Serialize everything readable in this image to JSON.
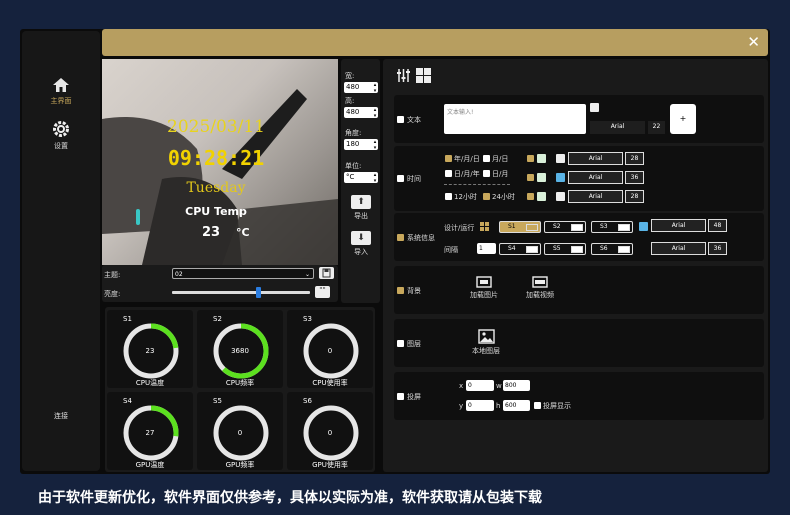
{
  "nav": {
    "home": "主界面",
    "settings": "设置",
    "connect": "连接"
  },
  "preview": {
    "date": "2025/03/11",
    "time": "09:28:21",
    "weekday": "Tuesday",
    "cpu_label": "CPU Temp",
    "cpu_value": "23",
    "cpu_unit": "°C"
  },
  "controls": {
    "theme_label": "主题:",
    "theme_value": "02",
    "brightness_label": "亮度:",
    "brightness": 0.62
  },
  "rightcol": {
    "width_label": "宽:",
    "width_value": "480",
    "height_label": "高:",
    "height_value": "480",
    "angle_label": "角度:",
    "angle_value": "180",
    "unit_label": "单位:",
    "unit_value": "°C",
    "export_label": "导出",
    "import_label": "导入"
  },
  "gauges": [
    {
      "slot": "S1",
      "value": "23",
      "caption": "CPU温度",
      "fill": 0.23
    },
    {
      "slot": "S2",
      "value": "3680",
      "caption": "CPU频率",
      "fill": 0.62
    },
    {
      "slot": "S3",
      "value": "0",
      "caption": "CPU使用率",
      "fill": 0
    },
    {
      "slot": "S4",
      "value": "27",
      "caption": "GPU温度",
      "fill": 0.27
    },
    {
      "slot": "S5",
      "value": "0",
      "caption": "GPU频率",
      "fill": 0
    },
    {
      "slot": "S6",
      "value": "0",
      "caption": "GPU使用率",
      "fill": 0
    }
  ],
  "text_row": {
    "label": "文本",
    "placeholder": "文本输入!",
    "font": "Arial",
    "size": "22",
    "add": "+"
  },
  "time_row": {
    "label": "时间",
    "ymd": "年/月/日",
    "md": "月/日",
    "dmy": "日/月/年",
    "dm": "日/月",
    "h12": "12小时",
    "h24": "24小时",
    "fonts": [
      {
        "font": "Arial",
        "size": "28"
      },
      {
        "font": "Arial",
        "size": "36"
      },
      {
        "font": "Arial",
        "size": "28"
      }
    ]
  },
  "sys_row": {
    "label": "系统信息",
    "design": "设计/运行",
    "interval": "间隔",
    "interval_value": "1",
    "slots": [
      "S1",
      "S2",
      "S3",
      "S4",
      "S5",
      "S6"
    ],
    "font1": "Arial",
    "size1": "48",
    "font2": "Arial",
    "size2": "36"
  },
  "bg_row": {
    "label": "背景",
    "load_image": "加载图片",
    "load_video": "加载视频"
  },
  "layer_row": {
    "label": "图层",
    "local_layer": "本地图层"
  },
  "cast_row": {
    "label": "投屏",
    "x_label": "x",
    "x": "0",
    "y_label": "y",
    "y": "0",
    "w_label": "w",
    "w": "800",
    "h_label": "h",
    "h": "600",
    "cast_display": "投屏显示"
  },
  "caption": "由于软件更新优化，软件界面仅供参考，具体以实际为准，软件获取请从包装下载"
}
